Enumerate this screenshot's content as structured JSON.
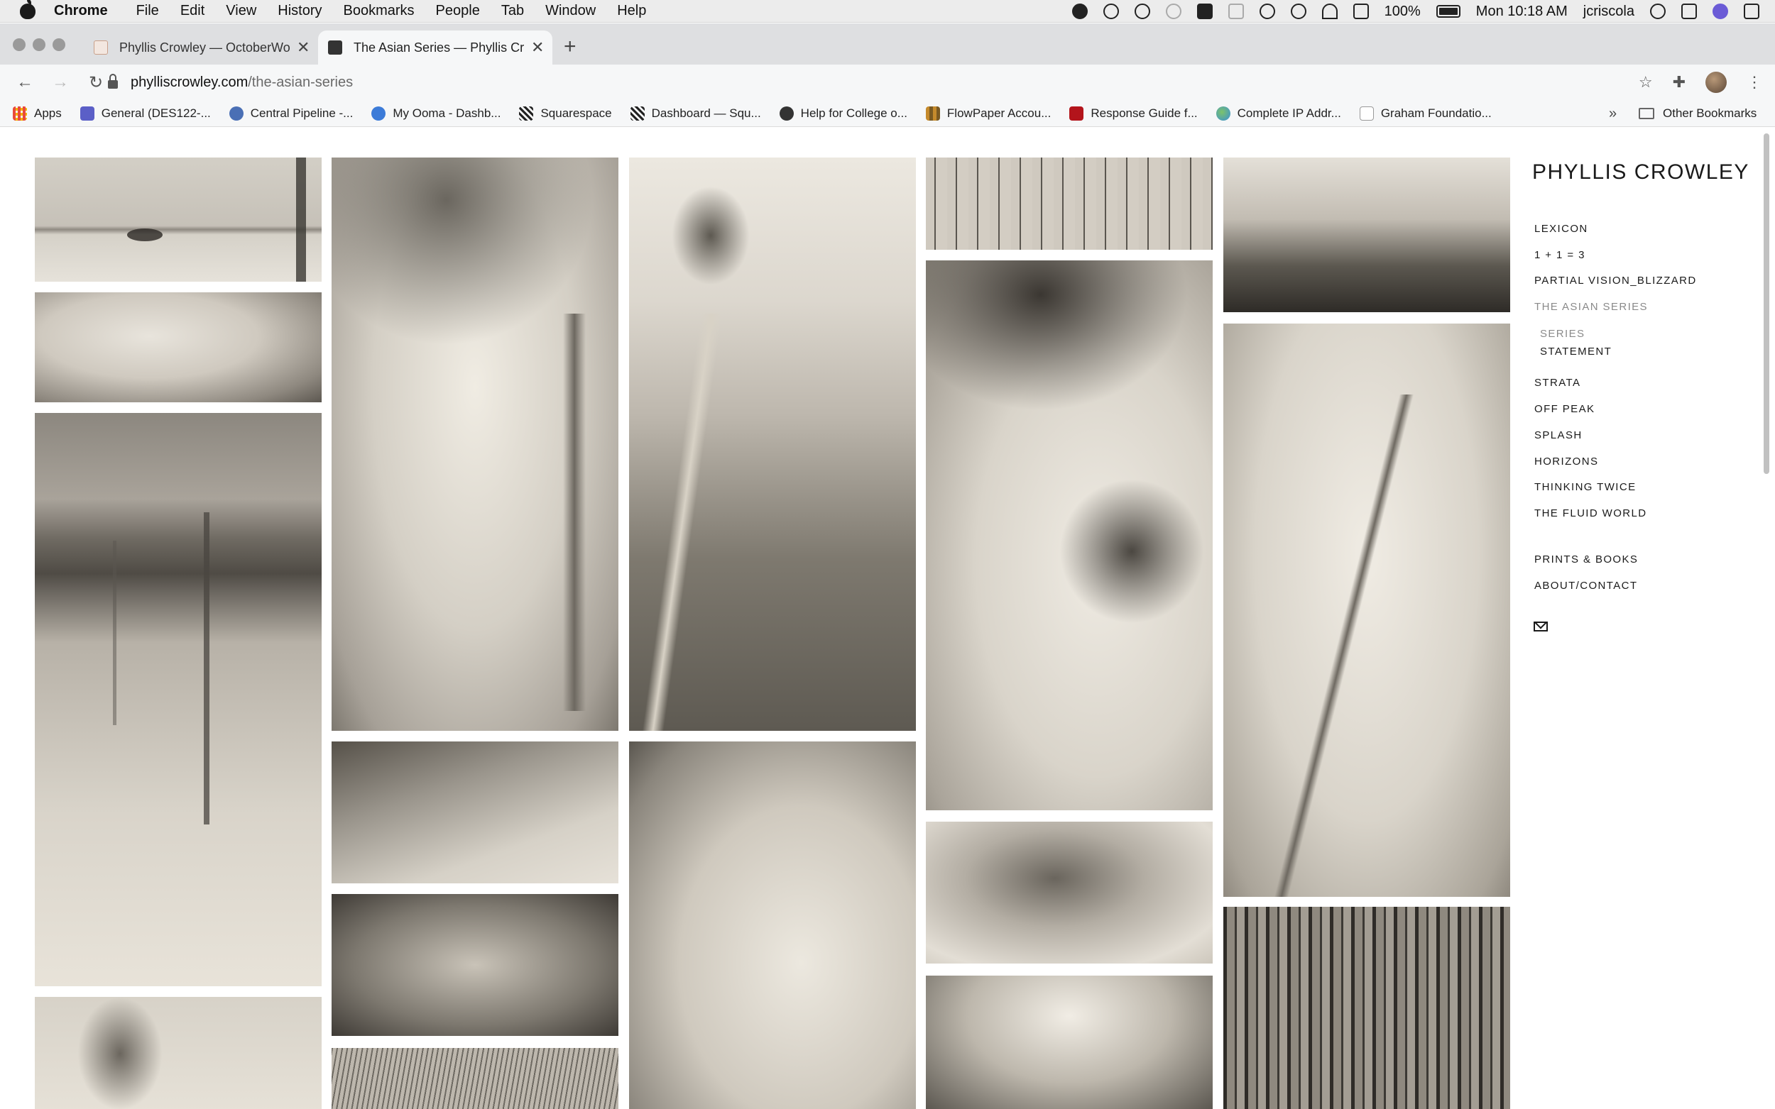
{
  "menubar": {
    "app_name": "Chrome",
    "items": [
      "File",
      "Edit",
      "View",
      "History",
      "Bookmarks",
      "People",
      "Tab",
      "Window",
      "Help"
    ],
    "battery": "100%",
    "clock": "Mon 10:18 AM",
    "user": "jcriscola"
  },
  "tabs": [
    {
      "title": "Phyllis Crowley — OctoberWor",
      "active": false
    },
    {
      "title": "The Asian Series — Phyllis Cro",
      "active": true
    }
  ],
  "address_bar": {
    "host": "phylliscrowley.com",
    "path": "/the-asian-series"
  },
  "bookmarks": [
    {
      "label": "Apps",
      "icon": "apps-grid-icon",
      "color": "#e9493c"
    },
    {
      "label": "General (DES122-...",
      "icon": "teams-icon",
      "color": "#5b5fc7"
    },
    {
      "label": "Central Pipeline -...",
      "icon": "pipeline-icon",
      "color": "#4a6fb5"
    },
    {
      "label": "My Ooma - Dashb...",
      "icon": "ooma-icon",
      "color": "#3c7bd8"
    },
    {
      "label": "Squarespace",
      "icon": "squarespace-icon",
      "color": "#222222"
    },
    {
      "label": "Dashboard — Squ...",
      "icon": "squarespace-icon",
      "color": "#222222"
    },
    {
      "label": "Help for College o...",
      "icon": "globe-icon",
      "color": "#333333"
    },
    {
      "label": "FlowPaper Accou...",
      "icon": "flowpaper-icon",
      "color": "#c58a2c"
    },
    {
      "label": "Response Guide f...",
      "icon": "ul-icon",
      "color": "#b3141b"
    },
    {
      "label": "Complete IP Addr...",
      "icon": "earth-icon",
      "color": "#3a8fd6"
    },
    {
      "label": "Graham Foundatio...",
      "icon": "gf-icon",
      "color": "#222222"
    }
  ],
  "other_bookmarks": "Other Bookmarks",
  "site": {
    "title": "PHYLLIS CROWLEY",
    "nav": [
      {
        "label": "LEXICON",
        "state": "normal"
      },
      {
        "label": "1 + 1 = 3",
        "state": "normal"
      },
      {
        "label": "PARTIAL VISION_BLIZZARD",
        "state": "normal"
      },
      {
        "label": "THE ASIAN SERIES",
        "state": "current"
      },
      {
        "label": "SERIES",
        "state": "sub-current"
      },
      {
        "label": "STATEMENT",
        "state": "sub"
      },
      {
        "label": "STRATA",
        "state": "normal"
      },
      {
        "label": "OFF PEAK",
        "state": "normal"
      },
      {
        "label": "SPLASH",
        "state": "normal"
      },
      {
        "label": "HORIZONS",
        "state": "normal"
      },
      {
        "label": "THINKING TWICE",
        "state": "normal"
      },
      {
        "label": "THE FLUID WORLD",
        "state": "normal"
      },
      {
        "label": "PRINTS & BOOKS",
        "state": "normal"
      },
      {
        "label": "ABOUT/CONTACT",
        "state": "normal"
      }
    ],
    "accent_current": "#8a8a8a",
    "photo_tone": "#e8e2d6"
  }
}
